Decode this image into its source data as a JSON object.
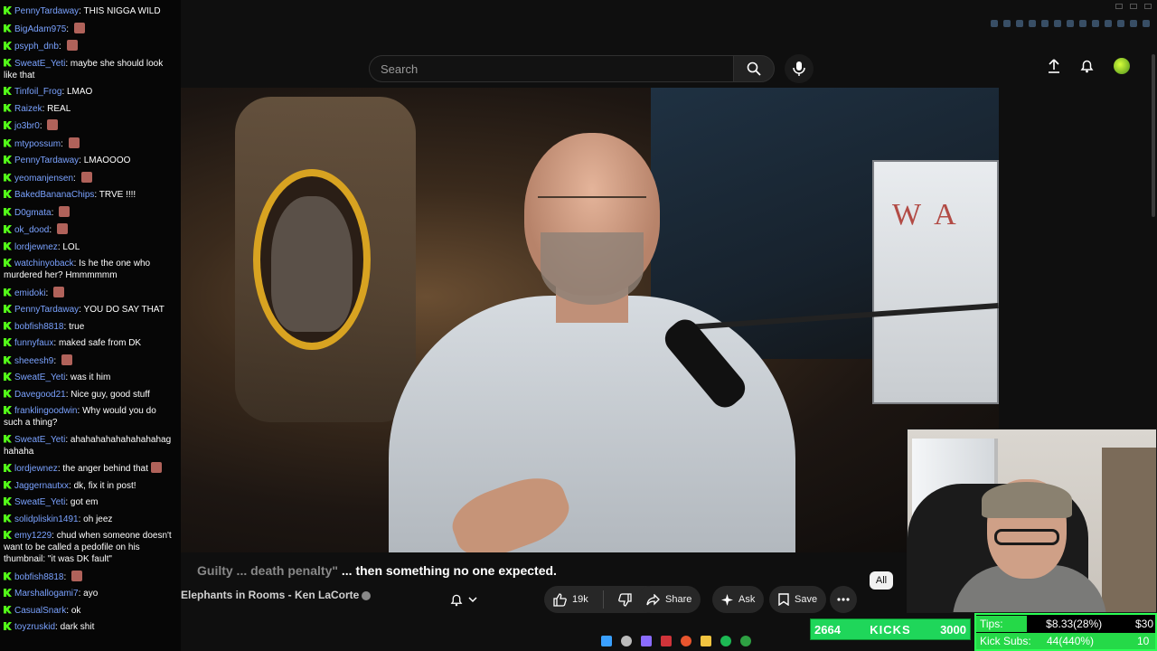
{
  "youtube": {
    "search": {
      "placeholder": "Search"
    },
    "caption_dim": "Guilty ... death penalty\"",
    "caption": " ... then something no one expected.",
    "channel_name": "Elephants in Rooms - Ken LaCorte",
    "filter_chip": "All",
    "actions": {
      "likes": "19k",
      "share": "Share",
      "ask": "Ask",
      "save": "Save"
    },
    "poster_text": "W A"
  },
  "chat": {
    "messages": [
      {
        "user": "PennyTardaway",
        "text": "THIS NIGGA WILD",
        "emote": false
      },
      {
        "user": "BigAdam975",
        "text": "",
        "emote": true
      },
      {
        "user": "psyph_dnb",
        "text": "",
        "emote": true
      },
      {
        "user": "SweatE_Yeti",
        "text": "maybe she should look like that",
        "emote": false
      },
      {
        "user": "Tinfoil_Frog",
        "text": "LMAO",
        "emote": false
      },
      {
        "user": "Raizek",
        "text": "REAL",
        "emote": false
      },
      {
        "user": "jo3br0",
        "text": "",
        "emote": true
      },
      {
        "user": "mtypossum",
        "text": "",
        "emote": true
      },
      {
        "user": "PennyTardaway",
        "text": "LMAOOOO",
        "emote": false
      },
      {
        "user": "yeomanjensen",
        "text": "",
        "emote": true
      },
      {
        "user": "BakedBananaChips",
        "text": "TRVE !!!!",
        "emote": false
      },
      {
        "user": "D0gmata",
        "text": "",
        "emote": true
      },
      {
        "user": "ok_dood",
        "text": "",
        "emote": true
      },
      {
        "user": "lordjewnez",
        "text": "LOL",
        "emote": false
      },
      {
        "user": "watchinyoback",
        "text": "Is he the one who murdered her? Hmmmmmm",
        "emote": false
      },
      {
        "user": "emidoki",
        "text": "",
        "emote": true
      },
      {
        "user": "PennyTardaway",
        "text": "YOU DO SAY THAT",
        "emote": false
      },
      {
        "user": "bobfish8818",
        "text": "true",
        "emote": false
      },
      {
        "user": "funnyfaux",
        "text": "maked safe from DK",
        "emote": false
      },
      {
        "user": "sheeesh9",
        "text": "",
        "emote": true
      },
      {
        "user": "SweatE_Yeti",
        "text": "was it him",
        "emote": false
      },
      {
        "user": "Davegood21",
        "text": "Nice guy, good stuff",
        "emote": false
      },
      {
        "user": "franklingoodwin",
        "text": "Why would you do such a thing?",
        "emote": false
      },
      {
        "user": "SweatE_Yeti",
        "text": "ahahahahahahahahahag hahaha",
        "emote": false
      },
      {
        "user": "lordjewnez",
        "text": "the anger behind that",
        "emote": true
      },
      {
        "user": "Jaggernautxx",
        "text": "dk, fix it in post!",
        "emote": false
      },
      {
        "user": "SweatE_Yeti",
        "text": "got em",
        "emote": false
      },
      {
        "user": "solidpliskin1491",
        "text": "oh jeez",
        "emote": false
      },
      {
        "user": "emy1229",
        "text": "chud when someone doesn't want to be called a pedofile on his thumbnail: \"it was DK fault\"",
        "emote": false
      },
      {
        "user": "bobfish8818",
        "text": "",
        "emote": true
      },
      {
        "user": "Marshallogami7",
        "text": "ayo",
        "emote": false
      },
      {
        "user": "CasualSnark",
        "text": "ok",
        "emote": false
      },
      {
        "user": "toyzruskid",
        "text": "dark shit",
        "emote": false
      }
    ]
  },
  "overlay": {
    "kicks_count": "2664",
    "kicks_label": "KICKS",
    "kicks_goal": "3000",
    "kicks_progress": 0.888,
    "tips_label": "Tips:",
    "tips_value": "$8.33(28%)",
    "tips_goal": "$30",
    "tips_progress": 0.28,
    "subs_label": "Kick Subs:",
    "subs_value": "44(440%)",
    "subs_goal": "10",
    "subs_progress": 1.0
  },
  "colors": {
    "kick_green": "#53fc18",
    "chat_username": "#7aa2ff",
    "youtube_bg": "#0f0f0f"
  },
  "icons": [
    "search-icon",
    "mic-icon",
    "upload-icon",
    "bell-icon",
    "like-icon",
    "dislike-icon",
    "share-icon",
    "sparkle-icon",
    "save-icon",
    "more-icon",
    "verified-icon",
    "kick-badge-icon"
  ]
}
